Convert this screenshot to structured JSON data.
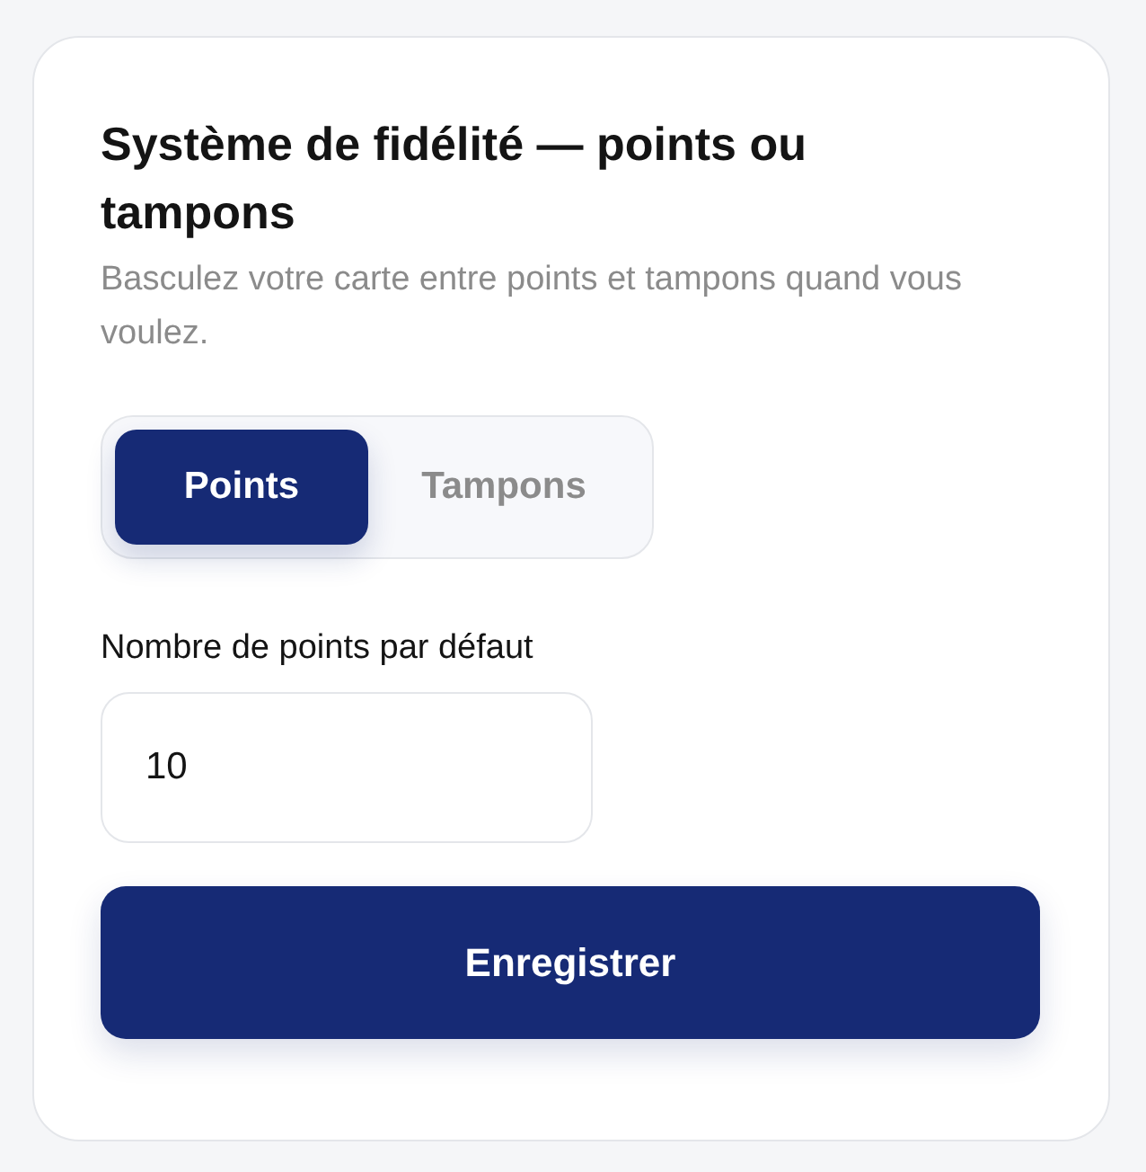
{
  "card": {
    "title": "Système de fidélité — points ou tampons",
    "subtitle": "Basculez votre carte entre points et tampons quand vous voulez.",
    "modes": [
      {
        "label": "Points",
        "selected": true
      },
      {
        "label": "Tampons",
        "selected": false
      }
    ],
    "field": {
      "label": "Nombre de points par défaut",
      "value": "10"
    },
    "button": "Enregistrer"
  }
}
